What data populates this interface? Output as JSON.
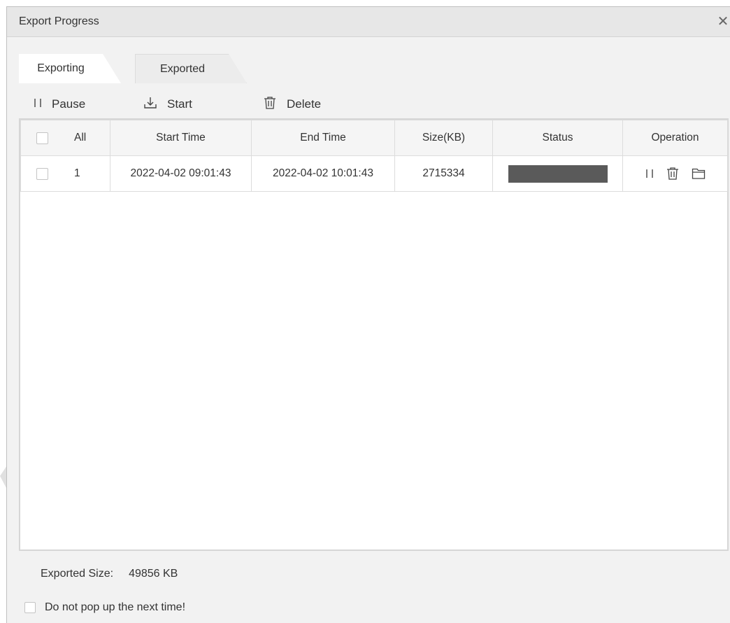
{
  "dialog": {
    "title": "Export Progress",
    "close_glyph": "✕"
  },
  "tabs": [
    {
      "label": "Exporting",
      "active": true
    },
    {
      "label": "Exported",
      "active": false
    }
  ],
  "toolbar": {
    "pause_label": "Pause",
    "start_label": "Start",
    "delete_label": "Delete"
  },
  "table": {
    "headers": [
      "All",
      "Start Time",
      "End Time",
      "Size(KB)",
      "Status",
      "Operation"
    ],
    "rows": [
      {
        "index": "1",
        "start_time": "2022-04-02 09:01:43",
        "end_time": "2022-04-02 10:01:43",
        "size": "2715334",
        "status_progress": 1.0
      }
    ]
  },
  "footer": {
    "exported_size_label": "Exported Size:",
    "exported_size_value": "49856 KB",
    "dont_pop_label": "Do not pop up the next time!"
  },
  "icons": {
    "pause": "pause-icon",
    "start": "download-icon",
    "delete": "trash-icon",
    "folder": "folder-icon",
    "close": "close-icon"
  },
  "colors": {
    "progress_fill": "#5a5a5a",
    "watermark_gray": "#dcdcdc",
    "watermark_blue": "#d3e6f5",
    "watermark_green": "#e6f3df"
  }
}
